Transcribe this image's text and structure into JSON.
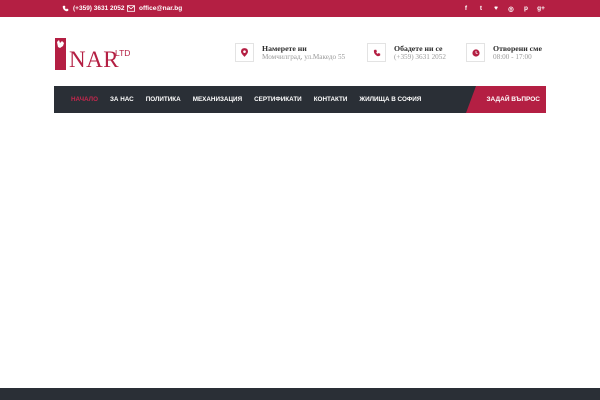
{
  "topbar": {
    "phone": "(+359) 3631 2052",
    "email": "office@nar.bg",
    "socials": [
      "f",
      "t",
      "♥",
      "◎",
      "p",
      "g+"
    ]
  },
  "logo": {
    "name": "NAR",
    "suffix": "LTD"
  },
  "info": [
    {
      "title": "Намерете ни",
      "subtitle": "Момчилград, ул.Македо 55",
      "icon": "map-pin-icon"
    },
    {
      "title": "Обадете ни се",
      "subtitle": "(+359) 3631 2052",
      "icon": "phone-icon"
    },
    {
      "title": "Отворени сме",
      "subtitle": "08:00 - 17:00",
      "icon": "clock-icon"
    }
  ],
  "nav": {
    "items": [
      "Начало",
      "За нас",
      "Политика",
      "Механизация",
      "Сертификати",
      "Контакти",
      "Жилища в София"
    ],
    "active_index": 0,
    "ask_label": "ЗАДАЙ ВЪПРОС"
  },
  "colors": {
    "accent": "#b41f43",
    "dark": "#2a2f36"
  }
}
